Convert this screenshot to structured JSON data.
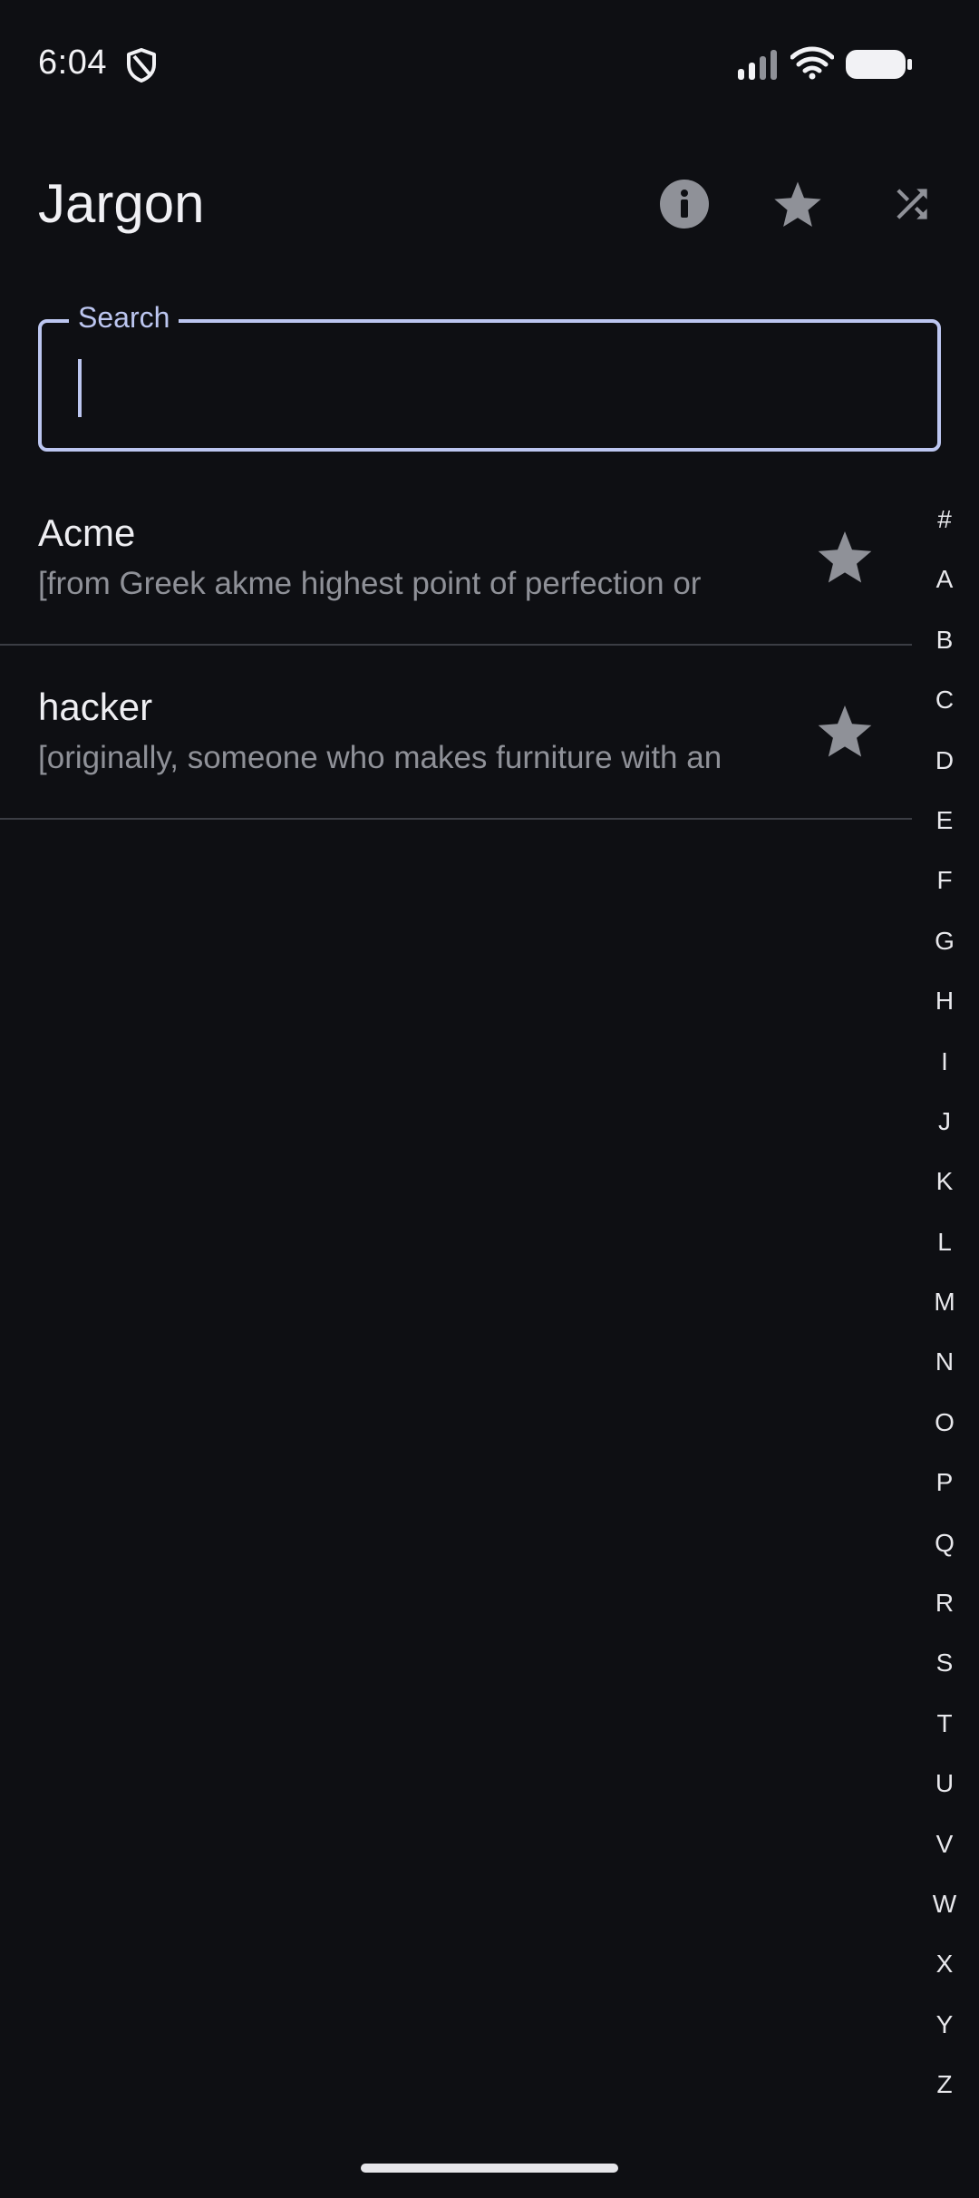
{
  "status_bar": {
    "time": "6:04",
    "icons": [
      "shield-icon",
      "signal-icon",
      "wifi-icon",
      "battery-icon"
    ]
  },
  "app_bar": {
    "title": "Jargon",
    "actions": [
      "info-icon",
      "star-icon",
      "shuffle-icon"
    ]
  },
  "search": {
    "label": "Search",
    "value": "",
    "placeholder": ""
  },
  "entries": [
    {
      "term": "Acme",
      "definition": "[from Greek akme highest point of perfection or",
      "starred": false
    },
    {
      "term": "hacker",
      "definition": "[originally, someone who makes furniture with an",
      "starred": false
    }
  ],
  "alphabet_index": [
    "#",
    "A",
    "B",
    "C",
    "D",
    "E",
    "F",
    "G",
    "H",
    "I",
    "J",
    "K",
    "L",
    "M",
    "N",
    "O",
    "P",
    "Q",
    "R",
    "S",
    "T",
    "U",
    "V",
    "W",
    "X",
    "Y",
    "Z"
  ],
  "colors": {
    "background": "#0e0f13",
    "accent": "#bcc6f0",
    "icon_gray": "#8f9198",
    "divider": "#3b3d44"
  }
}
